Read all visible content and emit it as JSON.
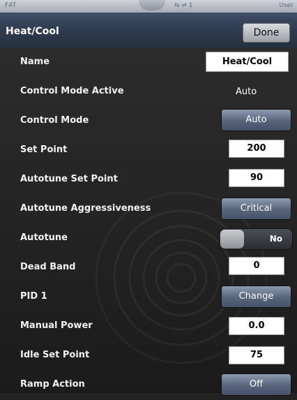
{
  "status_bar": {
    "left": "F4T",
    "middle": "⇆ ⇌ 1",
    "right": "User"
  },
  "header": {
    "title": "Heat/Cool",
    "done_label": "Done"
  },
  "rows": {
    "name": {
      "label": "Name",
      "value": "Heat/Cool"
    },
    "control_mode_active": {
      "label": "Control Mode Active",
      "value": "Auto"
    },
    "control_mode": {
      "label": "Control Mode",
      "value": "Auto"
    },
    "set_point": {
      "label": "Set Point",
      "value": "200"
    },
    "autotune_set_point": {
      "label": "Autotune Set Point",
      "value": "90"
    },
    "autotune_aggressiveness": {
      "label": "Autotune Aggressiveness",
      "value": "Critical"
    },
    "autotune": {
      "label": "Autotune",
      "value": "No"
    },
    "dead_band": {
      "label": "Dead Band",
      "value": "0"
    },
    "pid1": {
      "label": "PID 1",
      "value": "Change"
    },
    "manual_power": {
      "label": "Manual Power",
      "value": "0.0"
    },
    "idle_set_point": {
      "label": "Idle Set Point",
      "value": "75"
    },
    "ramp_action": {
      "label": "Ramp Action",
      "value": "Off"
    }
  }
}
